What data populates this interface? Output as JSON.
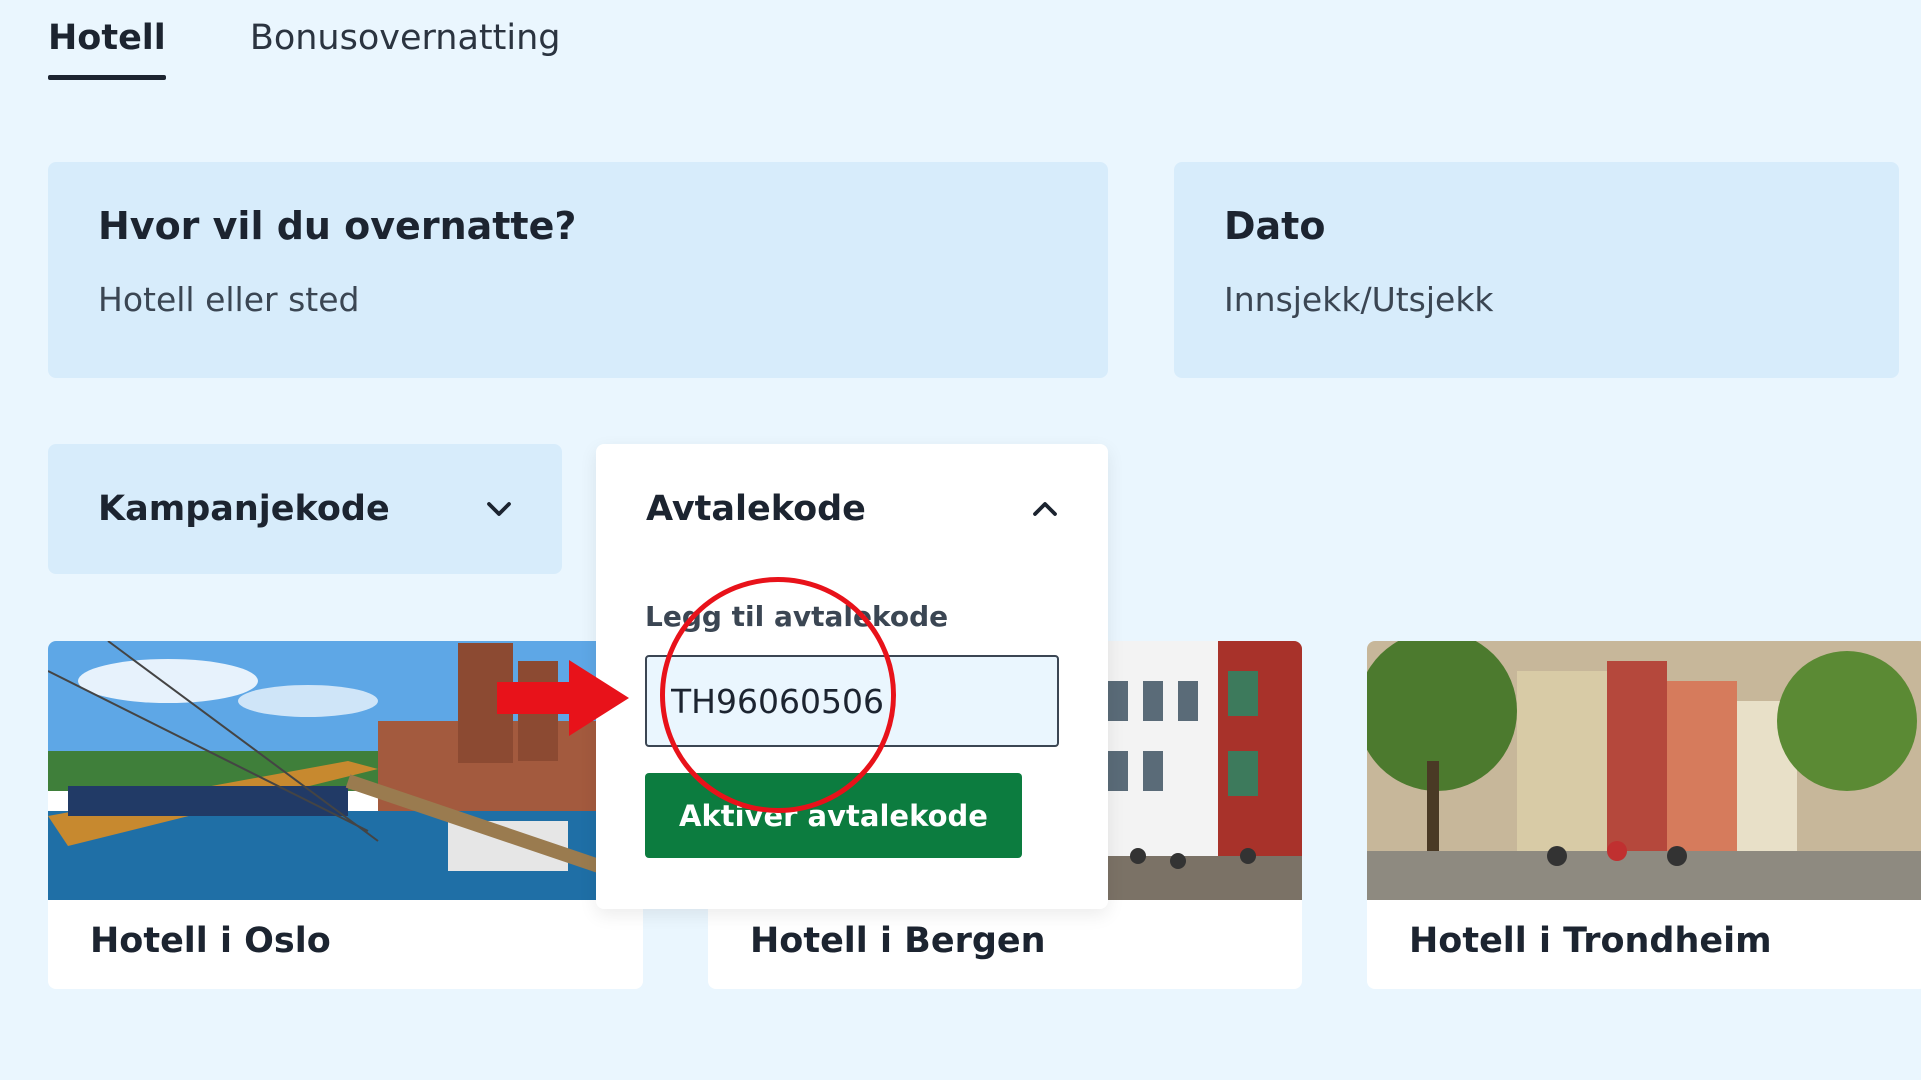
{
  "tabs": [
    {
      "label": "Hotell",
      "active": true
    },
    {
      "label": "Bonusovernatting",
      "active": false
    }
  ],
  "search": {
    "where": {
      "label": "Hvor vil du overnatte?",
      "placeholder": "Hotell eller sted"
    },
    "date": {
      "label": "Dato",
      "placeholder": "Innsjekk/Utsjekk"
    }
  },
  "codes": {
    "kampanje": {
      "label": "Kampanjekode",
      "icon": "chevron-down-icon",
      "expanded": false
    },
    "avtale": {
      "label": "Avtalekode",
      "icon": "chevron-up-icon",
      "expanded": true,
      "field_label": "Legg til avtalekode",
      "value": "TH96060506",
      "button_label": "Aktiver avtalekode"
    }
  },
  "cards": [
    {
      "name": "Hotell i Oslo"
    },
    {
      "name": "Hotell i Bergen"
    },
    {
      "name": "Hotell i Trondheim"
    }
  ],
  "colors": {
    "background": "#eaf6fe",
    "field_bg": "#d7ecfb",
    "button_green": "#0c7c3f",
    "annotation_red": "#e8121a",
    "text_dark": "#1c2430"
  }
}
